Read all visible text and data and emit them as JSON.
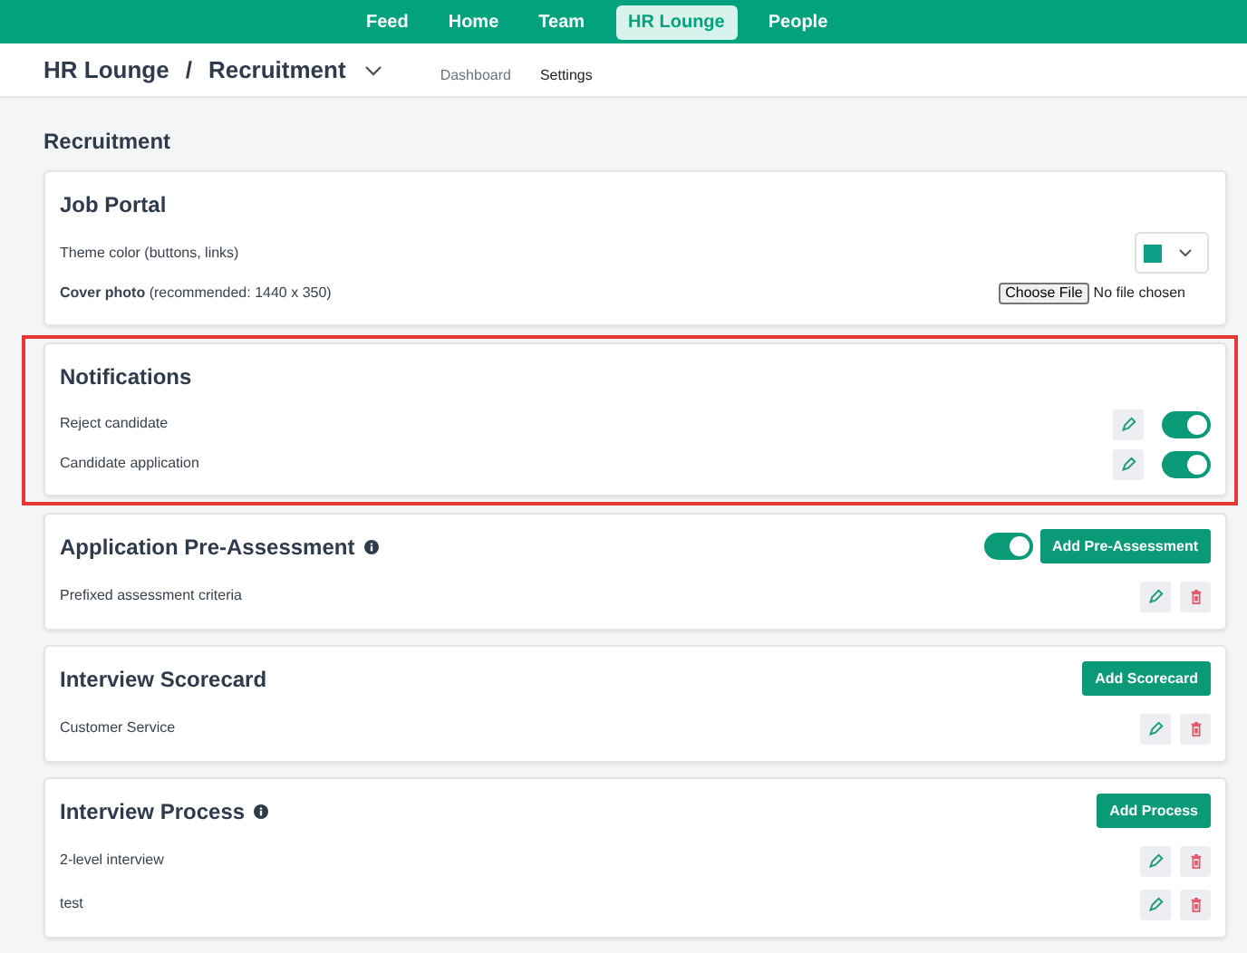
{
  "nav": [
    {
      "label": "Feed",
      "selected": false
    },
    {
      "label": "Home",
      "selected": false
    },
    {
      "label": "Team",
      "selected": false
    },
    {
      "label": "HR Lounge",
      "selected": true
    },
    {
      "label": "People",
      "selected": false
    }
  ],
  "breadcrumb": {
    "parent": "HR Lounge",
    "separator": "/",
    "current": "Recruitment"
  },
  "subtabs": [
    {
      "label": "Dashboard",
      "selected": false
    },
    {
      "label": "Settings",
      "selected": true
    }
  ],
  "page_title": "Recruitment",
  "sections": [
    {
      "title": "Job Portal",
      "rows": [
        {
          "kind": "color",
          "label": "Theme color (buttons, links)",
          "color": "#0fa08a"
        },
        {
          "kind": "file",
          "label": "**Cover photo** (recommended: 1440 x 350)",
          "button": "Choose File",
          "status": "No file chosen"
        }
      ]
    },
    {
      "title": "Notifications",
      "highlighted": true,
      "rows": [
        {
          "kind": "toggle",
          "label": "Reject candidate",
          "on": true
        },
        {
          "kind": "toggle",
          "label": "Candidate application",
          "on": true
        }
      ]
    },
    {
      "title": "Application Pre-Assessment",
      "info": true,
      "toggle": {
        "on": true
      },
      "button": "Add Pre-Assessment",
      "rows": [
        {
          "kind": "item",
          "label": "Prefixed assessment criteria"
        }
      ]
    },
    {
      "title": "Interview Scorecard",
      "button": "Add Scorecard",
      "rows": [
        {
          "kind": "item",
          "label": "Customer Service"
        }
      ]
    },
    {
      "title": "Interview Process",
      "info": true,
      "button": "Add Process",
      "rows": [
        {
          "kind": "item",
          "label": "2-level interview"
        },
        {
          "kind": "item",
          "label": "test"
        }
      ]
    }
  ]
}
